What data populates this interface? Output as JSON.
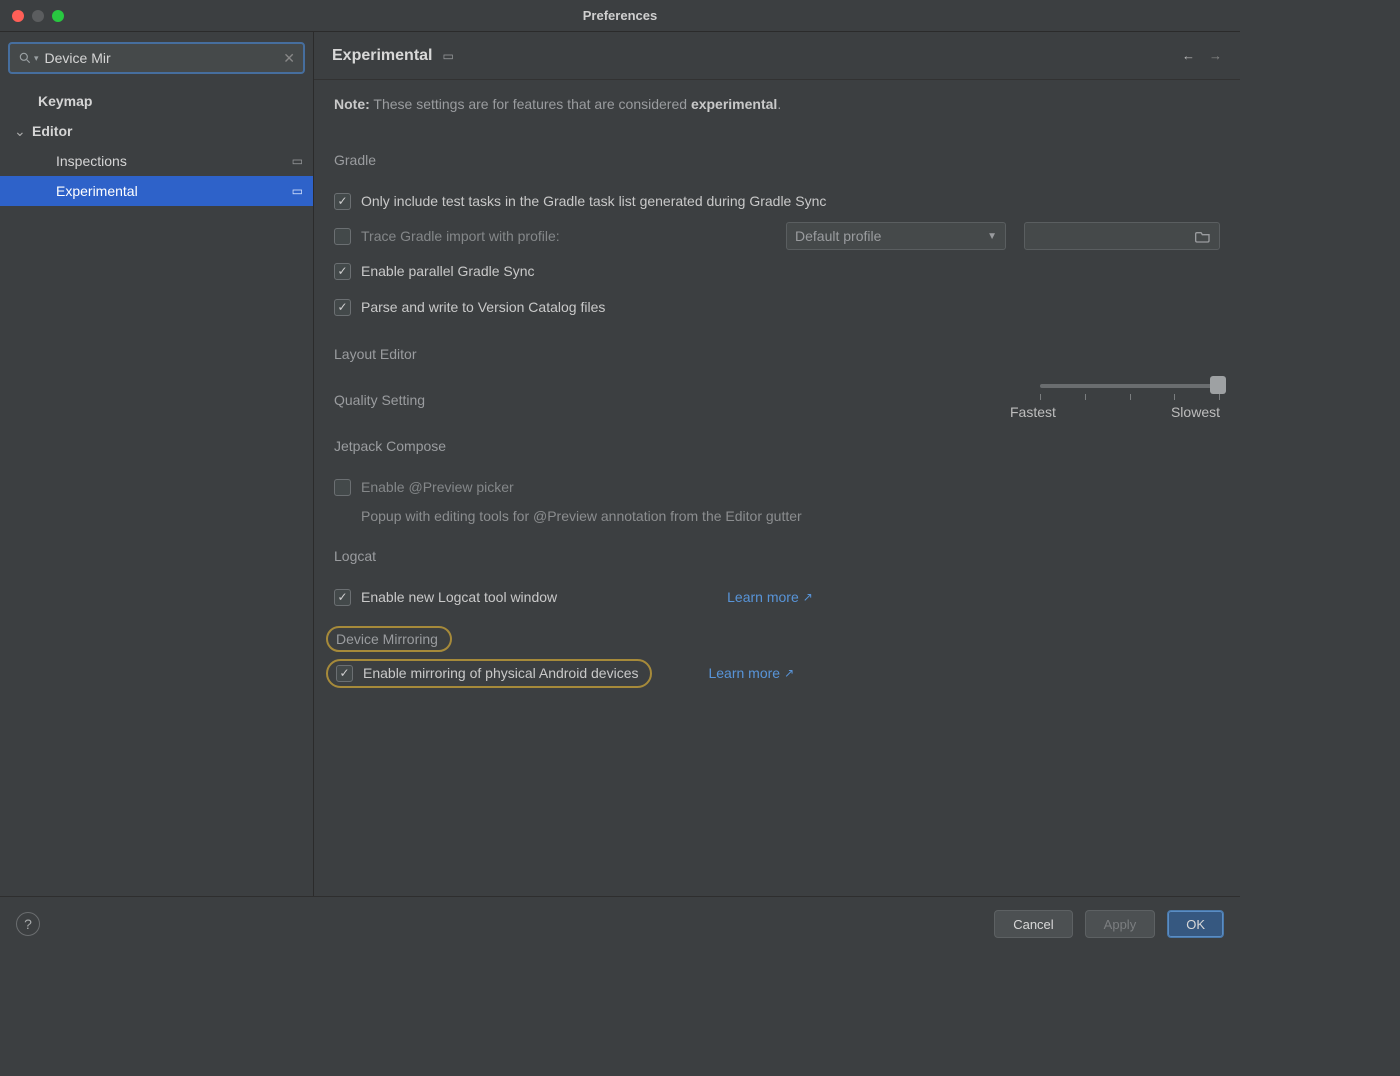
{
  "window": {
    "title": "Preferences"
  },
  "sidebar": {
    "search_value": "Device Mir",
    "items": [
      {
        "label": "Keymap",
        "level": 1,
        "arrow": false,
        "glyph": false,
        "selected": false
      },
      {
        "label": "Editor",
        "level": 1,
        "arrow": true,
        "glyph": false,
        "selected": false
      },
      {
        "label": "Inspections",
        "level": 2,
        "arrow": false,
        "glyph": true,
        "selected": false
      },
      {
        "label": "Experimental",
        "level": 2,
        "arrow": false,
        "glyph": true,
        "selected": true
      }
    ]
  },
  "header": {
    "title": "Experimental"
  },
  "note": {
    "prefix": "Note:",
    "text": "These settings are for features that are considered",
    "emph": "experimental",
    "suffix": "."
  },
  "gradle": {
    "title": "Gradle",
    "only_test_tasks": {
      "checked": true,
      "label": "Only include test tasks in the Gradle task list generated during Gradle Sync"
    },
    "trace_import": {
      "checked": false,
      "label": "Trace Gradle import with profile:"
    },
    "profile_combo": "Default profile",
    "enable_parallel": {
      "checked": true,
      "label": "Enable parallel Gradle Sync"
    },
    "parse_catalog": {
      "checked": true,
      "label": "Parse and write to Version Catalog files"
    }
  },
  "layout_editor": {
    "title": "Layout Editor",
    "quality_label": "Quality Setting",
    "fastest": "Fastest",
    "slowest": "Slowest"
  },
  "jetpack": {
    "title": "Jetpack Compose",
    "preview_picker": {
      "checked": false,
      "label": "Enable @Preview picker"
    },
    "hint": "Popup with editing tools for @Preview annotation from the Editor gutter"
  },
  "logcat": {
    "title": "Logcat",
    "enable_new": {
      "checked": true,
      "label": "Enable new Logcat tool window"
    },
    "learn_more": "Learn more"
  },
  "mirroring": {
    "title": "Device Mirroring",
    "enable": {
      "checked": true,
      "label": "Enable mirroring of physical Android devices"
    },
    "learn_more": "Learn more"
  },
  "footer": {
    "cancel": "Cancel",
    "apply": "Apply",
    "ok": "OK"
  }
}
